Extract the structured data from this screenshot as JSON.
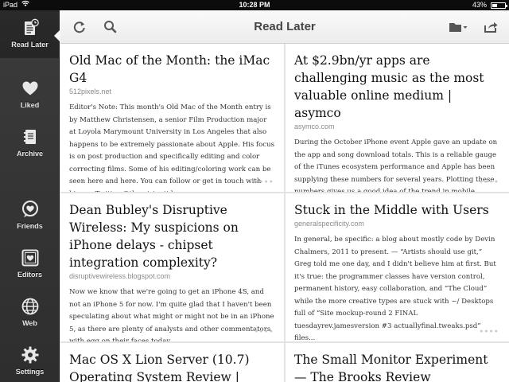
{
  "status_bar": {
    "carrier": "iPad",
    "time": "10:28 PM",
    "battery": "43%",
    "battery_level": 0.43
  },
  "sidebar": {
    "items": [
      {
        "label": "Read Later",
        "icon": "read-later-icon",
        "active": true
      },
      {
        "label": "Liked",
        "icon": "heart-icon",
        "active": false
      },
      {
        "label": "Archive",
        "icon": "archive-icon",
        "active": false
      },
      {
        "label": "Friends",
        "icon": "friends-heart-bubble-icon",
        "active": false
      },
      {
        "label": "Editors",
        "icon": "editors-frame-icon",
        "active": false
      },
      {
        "label": "Web",
        "icon": "globe-icon",
        "active": false
      },
      {
        "label": "Settings",
        "icon": "gear-icon",
        "active": false
      }
    ]
  },
  "toolbar": {
    "title": "Read Later",
    "left_icons": [
      "refresh-icon",
      "search-icon"
    ],
    "right_icons": [
      "folder-dropdown-icon",
      "share-icon"
    ]
  },
  "articles": [
    {
      "title": "Old Mac of the Month: the iMac G4",
      "domain": "512pixels.net",
      "excerpt": "Editor's Note: This month's Old Mac of the Month entry is by Matthew Christensen, a senior Film Production major at Loyola Marymount University in Los Angeles that also happens to be extremely passionate about Apple. His focus is on post production and specifically editing and color correcting films. Some of his editing/coloring work can be seen here and here. You can follow or get in touch with him on Twitter @the_risingtide. ..."
    },
    {
      "title": "At $2.9bn/yr apps are challenging music as the most valuable online medium | asymco",
      "domain": "asymco.com",
      "excerpt": "During the October iPhone event Apple gave an update on the app and song download totals. This is a reliable gauge of the iTunes ecosystem performance and Apple has been supplying these numbers for several years. Plotting these numbers gives us a good idea of the trend in mobile content consumption..."
    },
    {
      "title": "Dean Bubley's Disruptive Wireless: My suspicions on iPhone delays - chipset integration complexity?",
      "domain": "disruptivewireless.blogspot.com",
      "excerpt": "Now we know that we're going to get an iPhone 4S, and not an iPhone 5 for now. I'm quite glad that I haven't been speculating about what might or might not be in an iPhone 5, as there are plenty of analysts and other commentators with egg on their faces today. ..."
    },
    {
      "title": "Stuck in the Middle with Users",
      "domain": "generalspecificity.com",
      "excerpt": "In general, be specific: a blog about mostly code by Devin Chalmers, 2011 to present. — “Artists should use git,” Greg told me one day, and I didn't believe him at first. But it's true: the programmer classes have version control, permanent history, easy collaboration, and “The Cloud” while the more creative types are stuck with ~/ Desktops full of “Site mockup-round 2 FINAL tuesdayrev.jamesversion #3 actuallyfinal.tweaks.psd” files..."
    },
    {
      "title": "Mac OS X Lion Server (10.7) Operating System Review |",
      "domain": "",
      "excerpt": ""
    },
    {
      "title": "The Small Monitor Experiment — The Brooks Review",
      "domain": "",
      "excerpt": ""
    }
  ],
  "colors": {
    "sidebar_bg": "#333333",
    "toolbar_bg": "#f4f4f4",
    "card_bg": "#ffffff",
    "grid_bg": "#e3e3e3",
    "domain_text": "#8a8a8a"
  }
}
